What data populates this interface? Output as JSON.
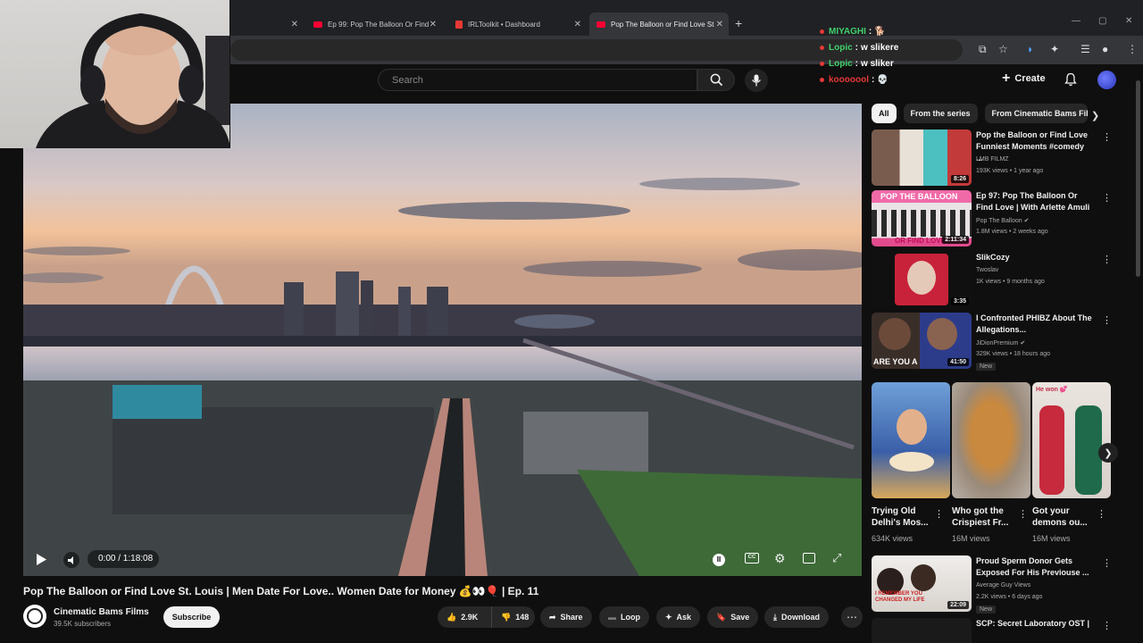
{
  "browser": {
    "tabs": [
      {
        "title": "Ep 99: Pop The Balloon Or Find",
        "icon": "youtube-icon",
        "active": false
      },
      {
        "title": "IRLToolkit • Dashboard",
        "icon": "irltoolkit-icon",
        "active": false
      },
      {
        "title": "Pop The Balloon or Find Love St",
        "icon": "youtube-icon",
        "active": true
      }
    ],
    "new_tab": "+"
  },
  "chat_overlay": [
    {
      "user": "MIYAGHI",
      "message": "🐕"
    },
    {
      "user": "Lopic",
      "message": "w slikere"
    },
    {
      "user": "Lopic",
      "message": "w sliker"
    },
    {
      "user": "kooooool",
      "message": "💀"
    }
  ],
  "youtube": {
    "search_placeholder": "Search",
    "create_label": "Create",
    "player": {
      "time": "0:00 / 1:18:08"
    },
    "video": {
      "title": "Pop The Balloon or Find Love St. Louis | Men Date For Love.. Women Date for Money 💰👀🎈 | Ep. 11",
      "channel": "Cinematic Bams Films",
      "subscribers": "39.5K subscribers",
      "subscribe_label": "Subscribe",
      "likes": "2.9K",
      "dislikes": "148",
      "share_label": "Share",
      "loop_label": "Loop",
      "ask_label": "Ask",
      "save_label": "Save",
      "download_label": "Download"
    },
    "chips": [
      "All",
      "From the series",
      "From Cinematic Bams Fil"
    ],
    "recommendations": [
      {
        "title": "Pop the Balloon or Find Love Funniest Moments #comedy ...",
        "channel": "LMB FILMZ",
        "verified": false,
        "meta": "193K views • 1 year ago",
        "duration": "8:26",
        "new": false
      },
      {
        "title": "Ep 97: Pop The Balloon Or Find Love | With Arlette Amuli",
        "channel": "Pop The Balloon",
        "verified": true,
        "meta": "1.8M views • 2 weeks ago",
        "duration": "2:11:34",
        "new": false
      },
      {
        "title": "SlikCozy",
        "channel": "Twoslav",
        "verified": false,
        "meta": "1K views • 9 months ago",
        "duration": "3:35",
        "new": false
      },
      {
        "title": "I Confronted PHIBZ About The Allegations...",
        "channel": "JiDionPremium",
        "verified": true,
        "meta": "329K views • 18 hours ago",
        "duration": "41:50",
        "new": true
      }
    ],
    "shorts": [
      {
        "title": "Trying Old Delhi's Mos...",
        "views": "634K views"
      },
      {
        "title": "Who got the Crispiest Fr...",
        "views": "16M views"
      },
      {
        "title": "Got your demons ou...",
        "views": "16M views"
      }
    ],
    "more_recommendations": [
      {
        "title": "Proud Sperm Donor Gets Exposed For His Previouse ...",
        "channel": "Average Guy Views",
        "meta": "2.2K views • 6 days ago",
        "duration": "22:09",
        "new": true
      },
      {
        "title": "SCP: Secret Laboratory OST |",
        "channel": "",
        "meta": "",
        "duration": "",
        "new": false
      }
    ],
    "thumb_texts": {
      "rec2": "POP THE BALLOON",
      "rec2b": "OR FIND LOVE",
      "rec4": "ARE YOU A",
      "short3": "He won 💕",
      "bottom": "I REMEMBER YOU CHANGED MY LIFE"
    }
  }
}
